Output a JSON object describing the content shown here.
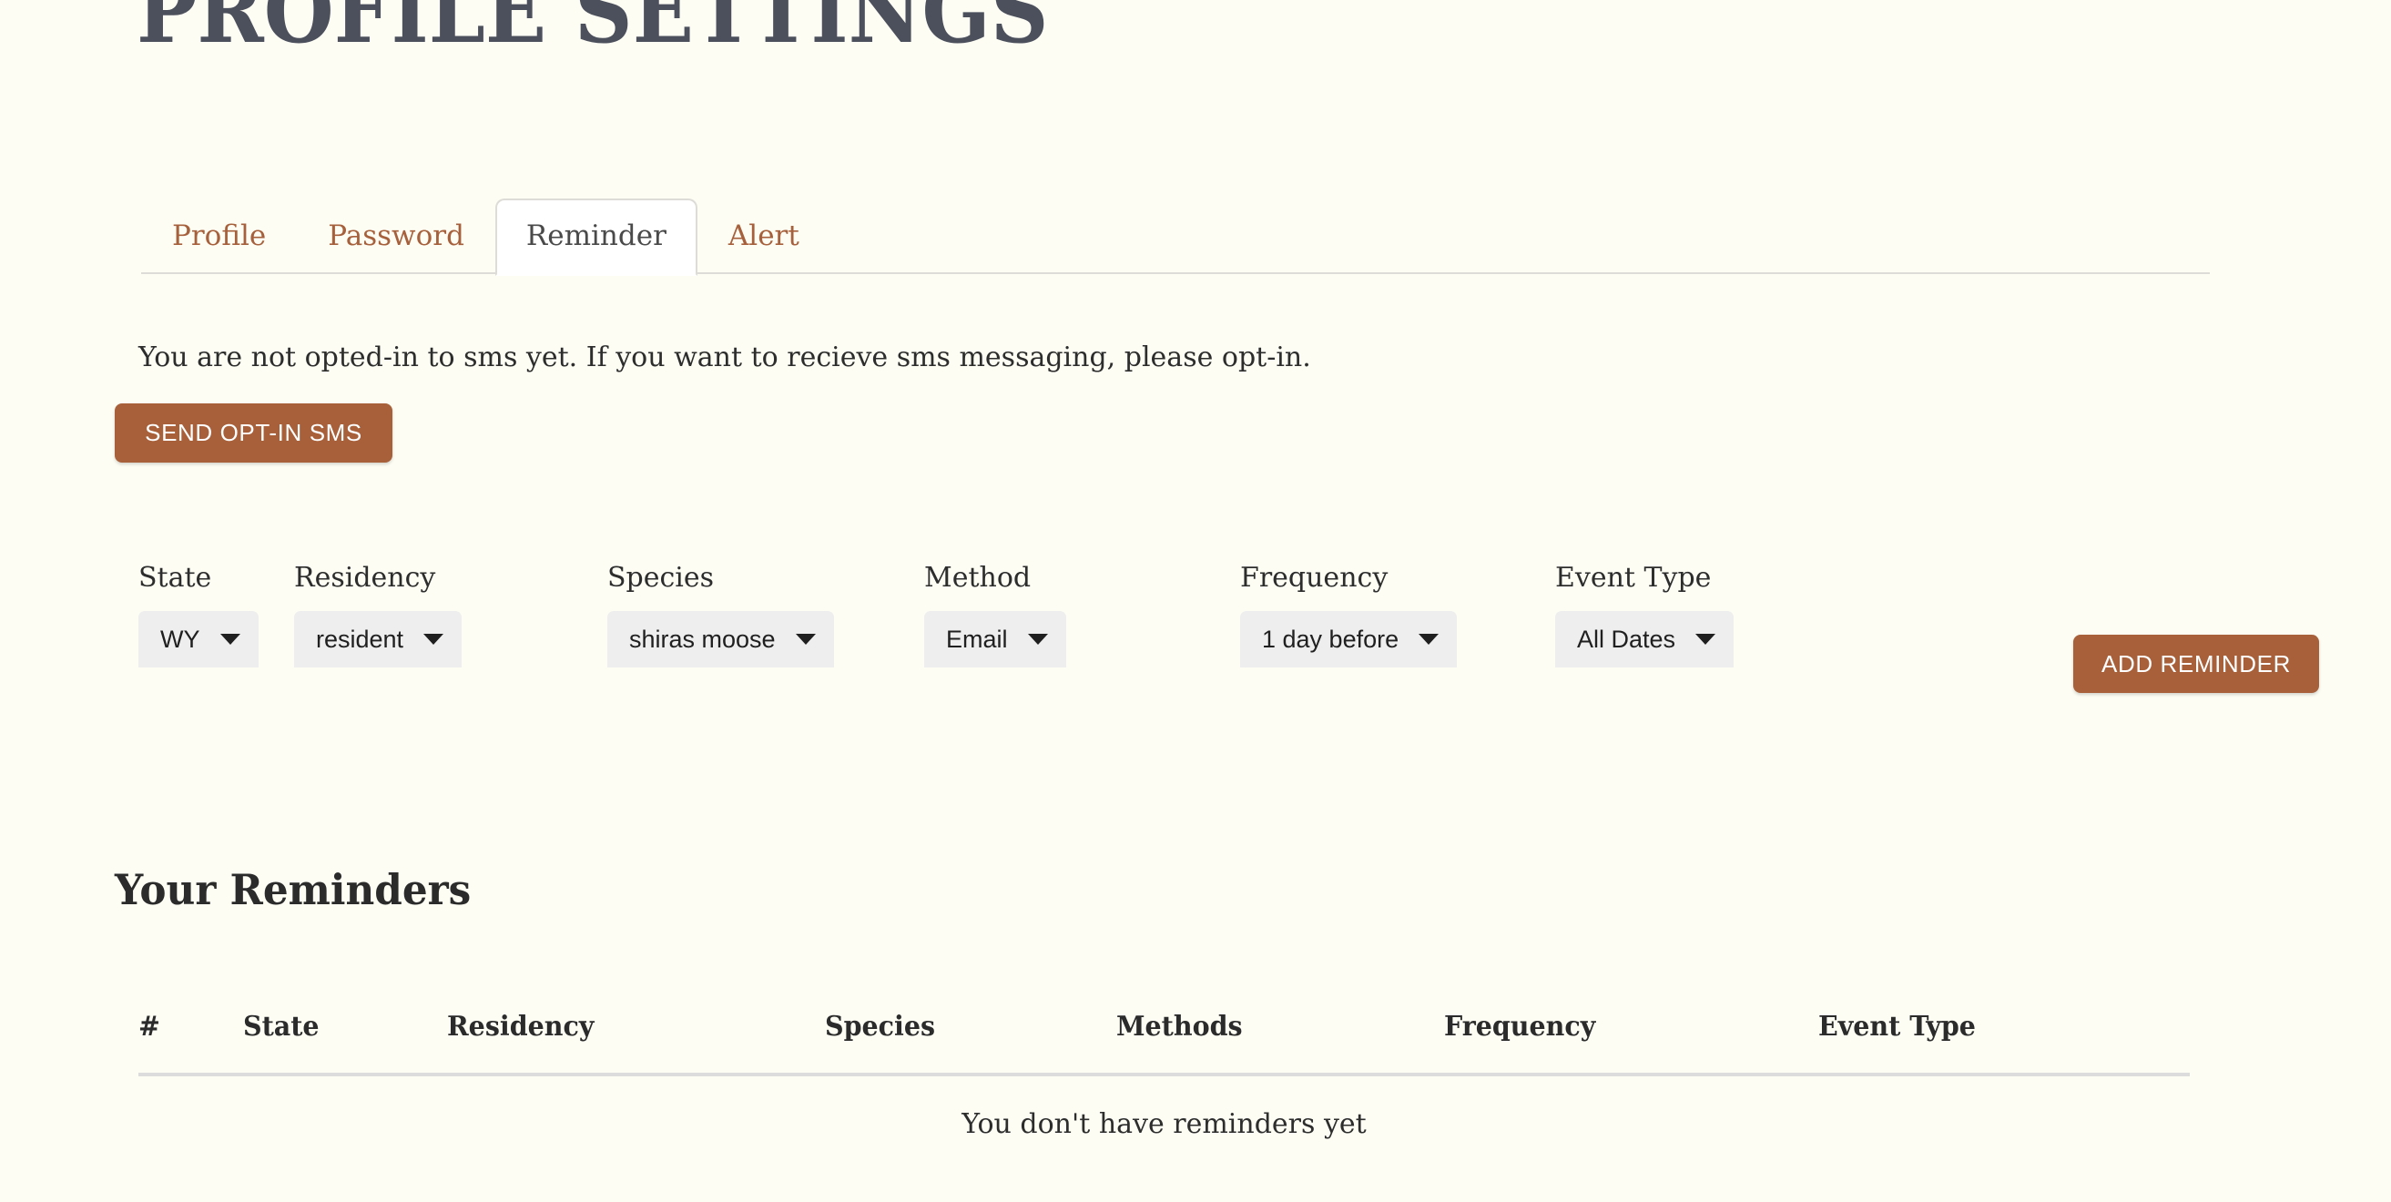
{
  "page": {
    "title": "PROFILE SETTINGS",
    "background_color": "#fdfdf4",
    "title_color": "#4c505c",
    "accent_color": "#a7603a",
    "link_color": "#a6613c"
  },
  "tabs": [
    {
      "label": "Profile",
      "active": false
    },
    {
      "label": "Password",
      "active": false
    },
    {
      "label": "Reminder",
      "active": true
    },
    {
      "label": "Alert",
      "active": false
    }
  ],
  "optin": {
    "message": "You are not opted-in to sms yet. If you want to recieve sms messaging, please opt-in.",
    "button_label": "SEND OPT-IN SMS"
  },
  "filters": {
    "fields": [
      {
        "label": "State",
        "value": "WY",
        "icon": "chevron-down-icon"
      },
      {
        "label": "Residency",
        "value": "resident",
        "icon": "chevron-down-icon"
      },
      {
        "label": "Species",
        "value": "shiras moose",
        "icon": "chevron-down-icon"
      },
      {
        "label": "Method",
        "value": "Email",
        "icon": "chevron-down-icon"
      },
      {
        "label": "Frequency",
        "value": "1 day before",
        "icon": "chevron-down-icon"
      },
      {
        "label": "Event Type",
        "value": "All Dates",
        "icon": "chevron-down-icon"
      }
    ],
    "add_button_label": "ADD REMINDER"
  },
  "reminders": {
    "section_title": "Your Reminders",
    "columns": [
      "#",
      "State",
      "Residency",
      "Species",
      "Methods",
      "Frequency",
      "Event Type"
    ],
    "rows": [],
    "empty_message": "You don't have reminders yet"
  }
}
